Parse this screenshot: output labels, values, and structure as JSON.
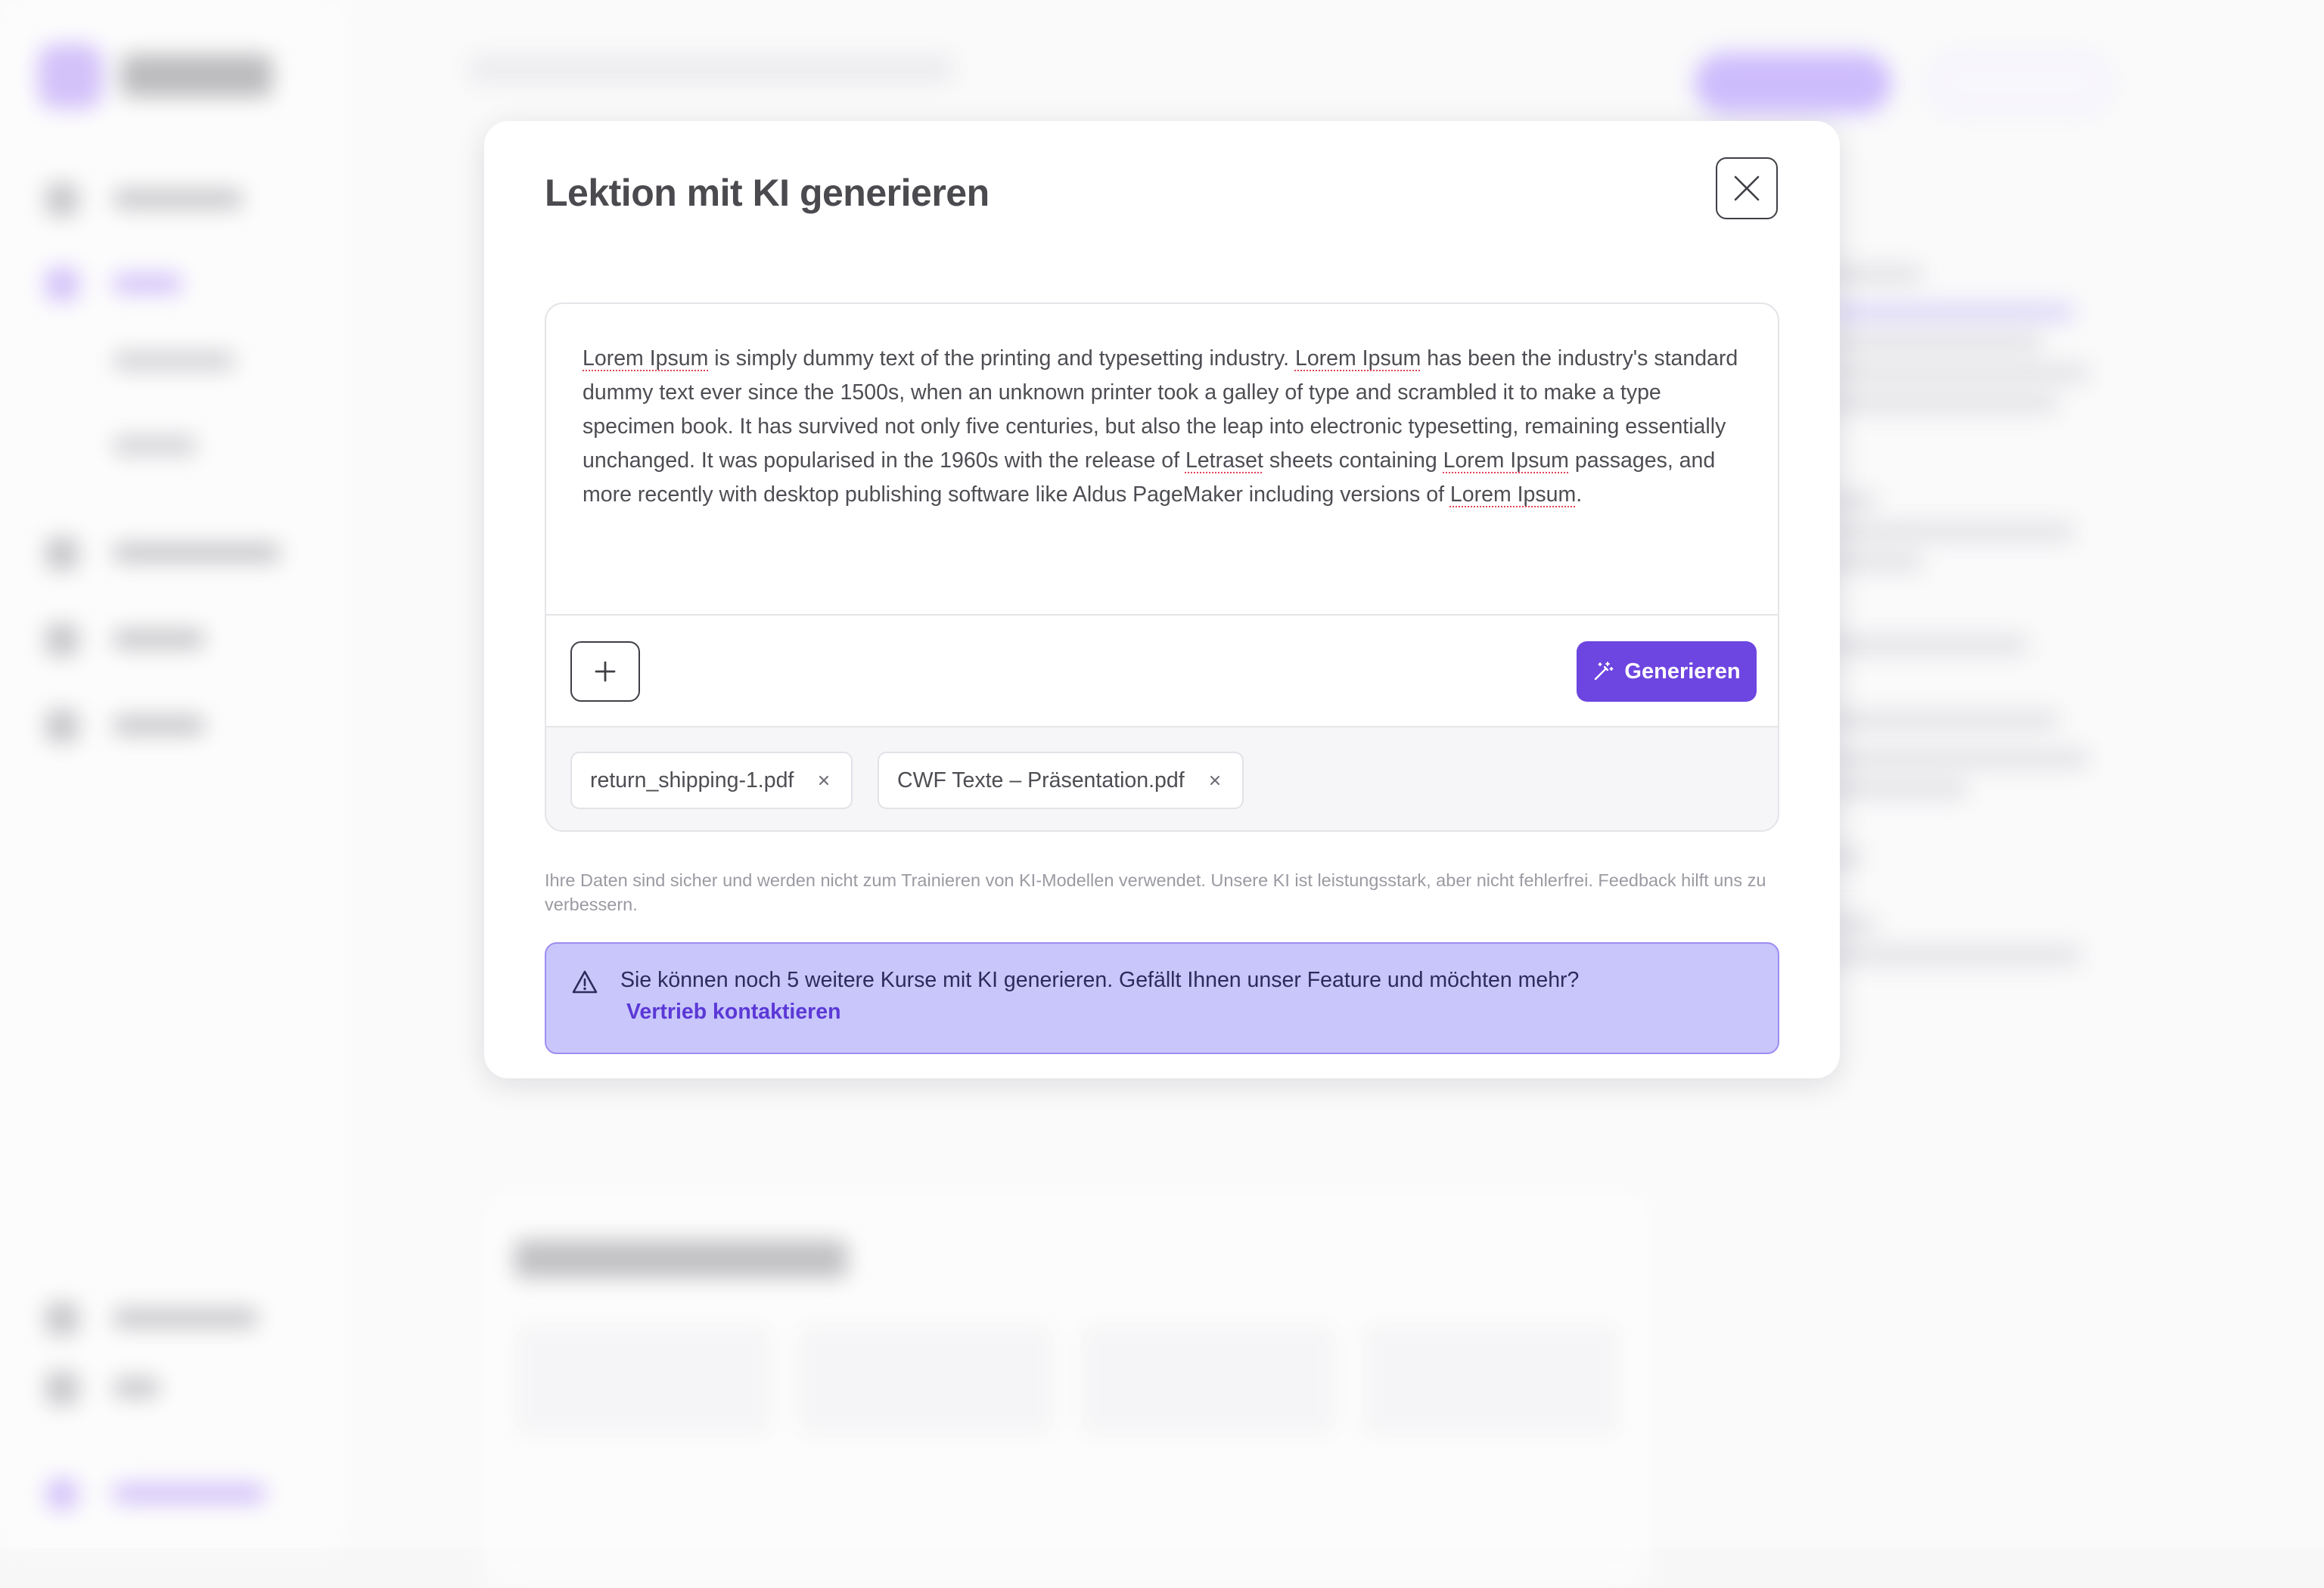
{
  "modal": {
    "title": "Lektion mit KI generieren",
    "prompt": {
      "segments": [
        {
          "text": "Lorem Ipsum",
          "misspelled": true
        },
        {
          "text": " is simply dummy text of the printing and typesetting industry. ",
          "misspelled": false
        },
        {
          "text": "Lorem Ipsum",
          "misspelled": true
        },
        {
          "text": " has been the industry's standard dummy text ever since the 1500s, when an unknown printer took a galley of type and scrambled it to make a type specimen book. It has survived not only five centuries, but also the leap into electronic typesetting, remaining essentially unchanged. It was popularised in the 1960s with the release of ",
          "misspelled": false
        },
        {
          "text": "Letraset",
          "misspelled": true
        },
        {
          "text": " sheets containing ",
          "misspelled": false
        },
        {
          "text": "Lorem Ipsum",
          "misspelled": true
        },
        {
          "text": " passages, and more recently with desktop publishing software like Aldus PageMaker including versions of ",
          "misspelled": false
        },
        {
          "text": "Lorem Ipsum",
          "misspelled": true
        },
        {
          "text": ".",
          "misspelled": false
        }
      ]
    },
    "add_button": {
      "icon": "plus-icon"
    },
    "generate_button": {
      "label": "Generieren",
      "icon": "magic-wand-icon",
      "color": "#6d45e0"
    },
    "attachments": [
      {
        "name": "return_shipping-1.pdf"
      },
      {
        "name": "CWF Texte – Präsentation.pdf"
      }
    ],
    "disclaimer": "Ihre Daten sind sicher und werden nicht zum Trainieren von KI-Modellen verwendet. Unsere KI ist leistungsstark, aber nicht fehlerfrei. Feedback hilft uns zu verbessern.",
    "quota_banner": {
      "icon": "warning-icon",
      "message": "Sie können noch 5 weitere Kurse mit KI generieren. Gefällt Ihnen unser Feature und möchten mehr?",
      "link_label": "Vertrieb kontaktieren",
      "background": "#c8c6fb",
      "accent": "#5b38d6"
    }
  }
}
